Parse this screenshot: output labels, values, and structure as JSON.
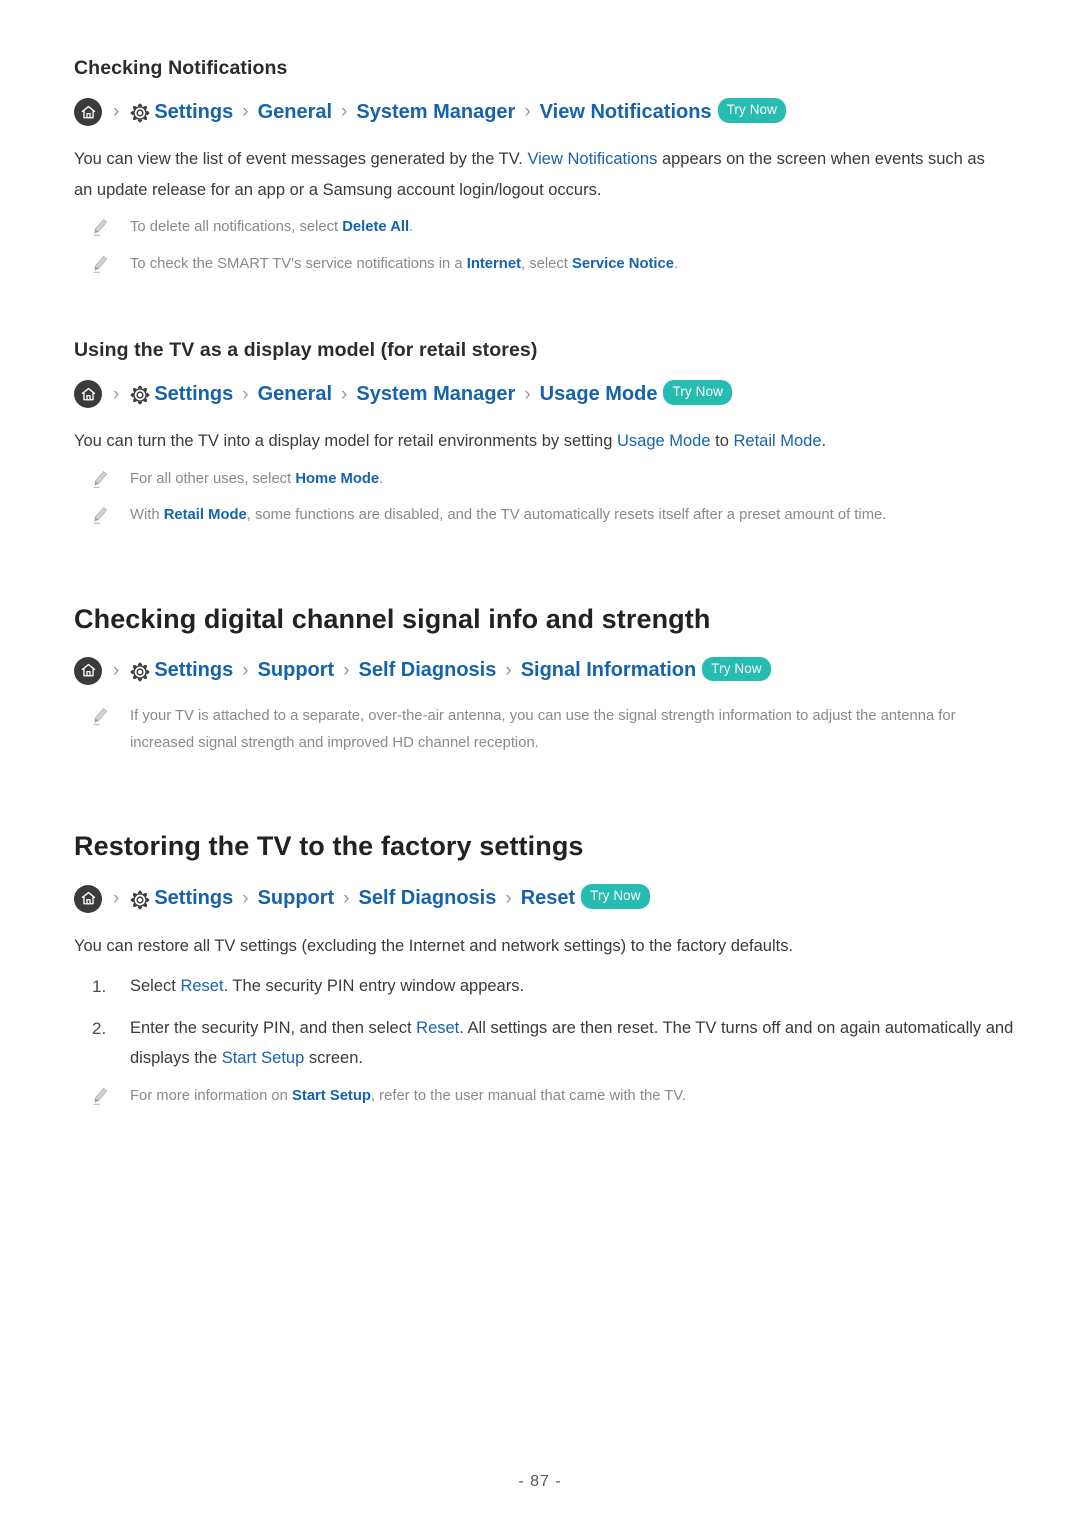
{
  "document": {
    "page_number": "- 87 -"
  },
  "sections": [
    {
      "heading": "Checking Notifications",
      "heading_level": "sub",
      "breadcrumb": {
        "home_icon": "home-icon",
        "gear_icon": "gear-icon",
        "separator": "›",
        "items": [
          "Settings",
          "General",
          "System Manager",
          "View Notifications"
        ],
        "badge": "Try Now"
      },
      "paragraph": {
        "part1": "You can view the list of event messages generated by the TV. ",
        "link1": "View Notifications",
        "part2": " appears on the screen when events such as an update release for an app or a Samsung account login/logout occurs."
      },
      "notes": [
        {
          "icon": "pencil-note-icon",
          "part1": "To delete all notifications, select ",
          "link1": "Delete All",
          "part2": "."
        },
        {
          "icon": "pencil-note-icon",
          "part1": "To check the SMART TV's service notifications in a ",
          "link1": "Internet",
          "part2": ", select ",
          "link2": "Service Notice",
          "part3": "."
        }
      ]
    },
    {
      "heading": "Using the TV as a display model (for retail stores)",
      "heading_level": "sub",
      "breadcrumb": {
        "home_icon": "home-icon",
        "gear_icon": "gear-icon",
        "separator": "›",
        "items": [
          "Settings",
          "General",
          "System Manager",
          "Usage Mode"
        ],
        "badge": "Try Now"
      },
      "paragraph": {
        "part1": "You can turn the TV into a display model for retail environments by setting ",
        "link1": "Usage Mode",
        "part2": " to ",
        "link2": "Retail Mode",
        "part3": "."
      },
      "notes": [
        {
          "icon": "pencil-note-icon",
          "part1": "For all other uses, select ",
          "link1": "Home Mode",
          "part2": "."
        },
        {
          "icon": "pencil-note-icon",
          "part1": "With ",
          "link1": "Retail Mode",
          "part2": ", some functions are disabled, and the TV automatically resets itself after a preset amount of time."
        }
      ]
    },
    {
      "heading": "Checking digital channel signal info and strength",
      "heading_level": "main",
      "breadcrumb": {
        "home_icon": "home-icon",
        "gear_icon": "gear-icon",
        "separator": "›",
        "items": [
          "Settings",
          "Support",
          "Self Diagnosis",
          "Signal Information"
        ],
        "badge": "Try Now"
      },
      "notes": [
        {
          "icon": "pencil-note-icon",
          "part1": "If your TV is attached to a separate, over-the-air antenna, you can use the signal strength information to adjust the antenna for increased signal strength and improved HD channel reception."
        }
      ]
    },
    {
      "heading": "Restoring the TV to the factory settings",
      "heading_level": "main",
      "breadcrumb": {
        "home_icon": "home-icon",
        "gear_icon": "gear-icon",
        "separator": "›",
        "items": [
          "Settings",
          "Support",
          "Self Diagnosis",
          "Reset"
        ],
        "badge": "Try Now"
      },
      "paragraph": {
        "part1": "You can restore all TV settings (excluding the Internet and network settings) to the factory defaults."
      },
      "steps": [
        {
          "number": "1.",
          "part1": "Select ",
          "link1": "Reset",
          "part2": ". The security PIN entry window appears."
        },
        {
          "number": "2.",
          "part1": "Enter the security PIN, and then select ",
          "link1": "Reset",
          "part2": ". All settings are then reset. The TV turns off and on again automatically and displays the ",
          "link2": "Start Setup",
          "part3": " screen."
        }
      ],
      "notes": [
        {
          "icon": "pencil-note-icon",
          "part1": "For more information on ",
          "link1": "Start Setup",
          "part2": ", refer to the user manual that came with the TV."
        }
      ]
    }
  ],
  "colors": {
    "link": "#1663ad",
    "badge_bg": "#26bcb2",
    "note_text": "#8a8a8a",
    "body_text": "#3a3a3a",
    "home_circle": "#3b3b3b"
  }
}
